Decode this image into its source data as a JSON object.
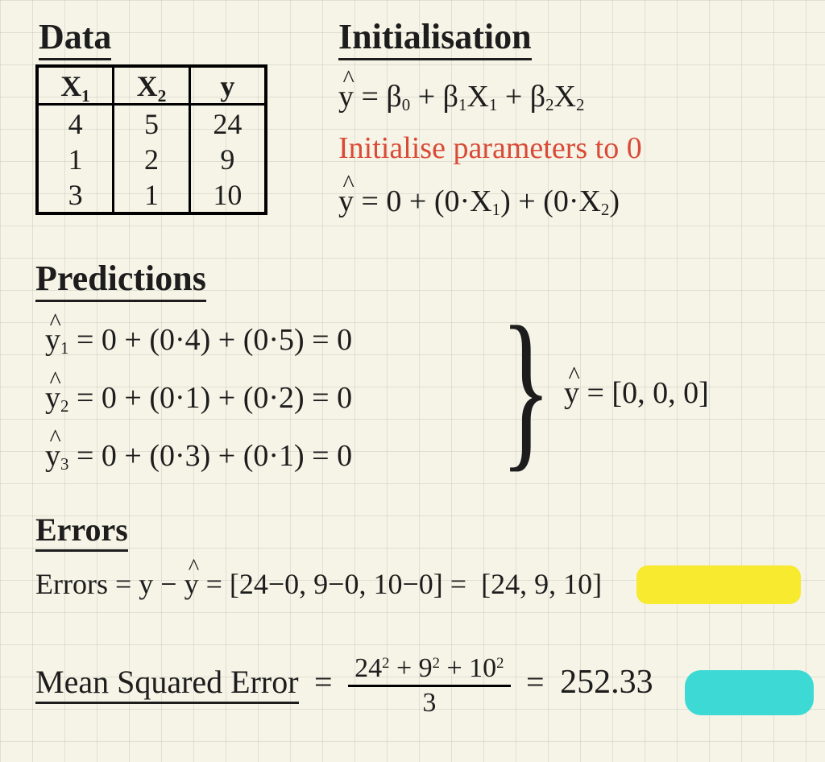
{
  "headings": {
    "data": "Data",
    "init": "Initialisation",
    "pred": "Predictions",
    "errs": "Errors",
    "mse": "Mean Squared Error"
  },
  "data_table": {
    "columns": [
      "X₁",
      "X₂",
      "y"
    ],
    "rows": [
      [
        "4",
        "5",
        "24"
      ],
      [
        "1",
        "2",
        "9"
      ],
      [
        "3",
        "1",
        "10"
      ]
    ]
  },
  "initialisation": {
    "model_form": "ŷ = β₀ + β₁X₁ + β₂X₂",
    "note": "Initialise parameters to 0",
    "model_init": "ŷ = 0 + (0·X₁) + (0·X₂)"
  },
  "predictions": {
    "y1": "ŷ₁ = 0 + (0·4) + (0·5) = 0",
    "y2": "ŷ₂ = 0 + (0·1) + (0·2) = 0",
    "y3": "ŷ₃ = 0 + (0·3) + (0·1) = 0",
    "vector": "ŷ = [0, 0, 0]"
  },
  "errors": {
    "line": "Errors = y − ŷ = [24−0, 9−0, 10−0] = ",
    "result": "[24, 9, 10]"
  },
  "mse": {
    "eq": " = ",
    "numerator": "24² + 9² + 10²",
    "denominator": "3",
    "eq2": " = ",
    "result": "252.33"
  },
  "chart_data": {
    "type": "table",
    "title": "Linear regression initialisation worked example",
    "data": {
      "X1": [
        4,
        1,
        3
      ],
      "X2": [
        5,
        2,
        1
      ],
      "y": [
        24,
        9,
        10
      ]
    },
    "parameters_initial": {
      "beta0": 0,
      "beta1": 0,
      "beta2": 0
    },
    "y_hat": [
      0,
      0,
      0
    ],
    "errors": [
      24,
      9,
      10
    ],
    "mse": 252.33
  }
}
